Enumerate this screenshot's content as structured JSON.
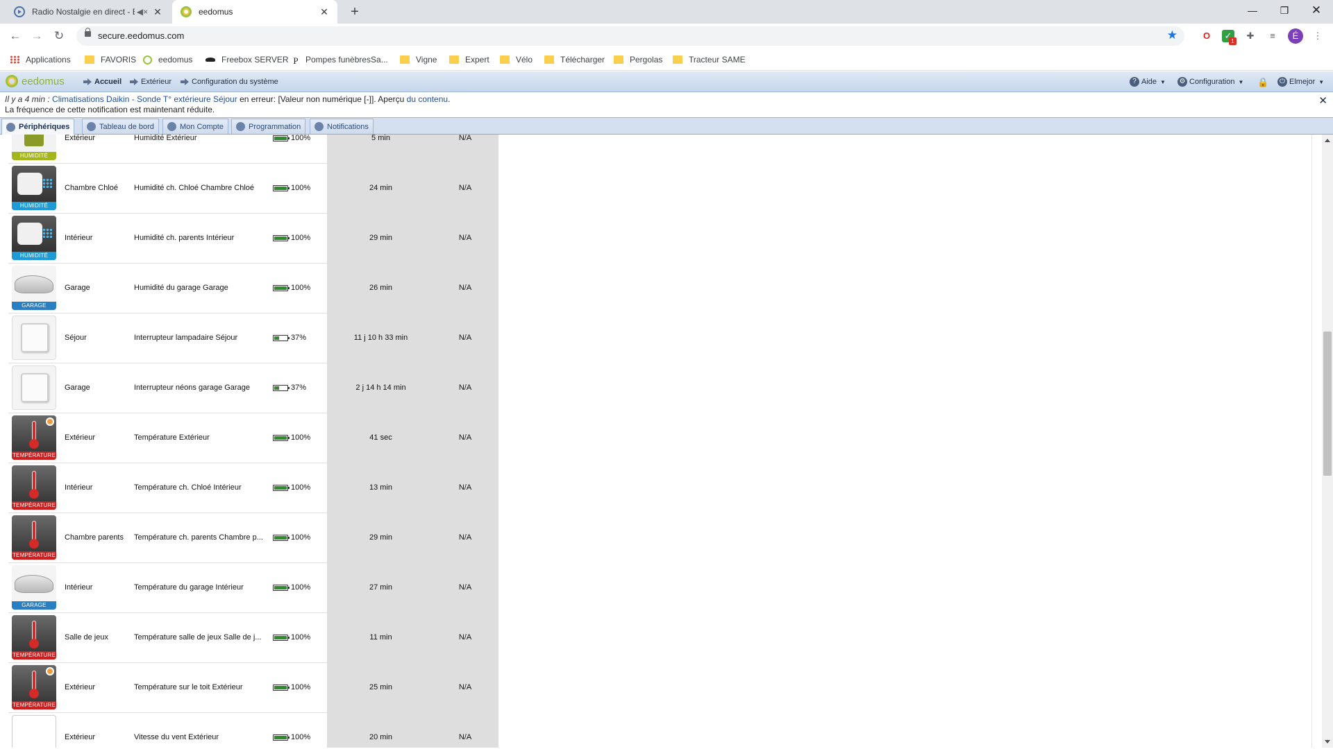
{
  "browser": {
    "tabs": [
      {
        "title": "Radio Nostalgie en direct - É",
        "active": false
      },
      {
        "title": "eedomus",
        "active": true
      }
    ],
    "url": "secure.eedomus.com",
    "profile_initial": "É",
    "extension_badge": "1",
    "bookmarks": [
      {
        "label": "Applications",
        "icon": "apps-grid-icon"
      },
      {
        "label": "FAVORIS",
        "icon": "folder-icon"
      },
      {
        "label": "eedomus",
        "icon": "eedomus-icon"
      },
      {
        "label": "Freebox SERVER",
        "icon": "freebox-icon"
      },
      {
        "label": "Pompes funèbresSa...",
        "icon": "pompes-funebres-icon"
      },
      {
        "label": "Vigne",
        "icon": "folder-icon"
      },
      {
        "label": "Expert",
        "icon": "folder-icon"
      },
      {
        "label": "Vélo",
        "icon": "folder-icon"
      },
      {
        "label": "Télécharger",
        "icon": "folder-icon"
      },
      {
        "label": "Pergolas",
        "icon": "folder-icon"
      },
      {
        "label": "Tracteur SAME",
        "icon": "folder-icon"
      }
    ]
  },
  "app": {
    "logo": "eedomus",
    "breadcrumb": [
      "Accueil",
      "Extérieur",
      "Configuration du système"
    ],
    "help_label": "Aide",
    "config_label": "Configuration",
    "user_label": "Elmejor",
    "notification": {
      "prefix": "Il y a 4 min :",
      "device_link": "Climatisations Daikin - Sonde T° extérieure Séjour",
      "middle": "en erreur: [Valeur non numérique [-]]. Aperçu",
      "content_link": "du contenu",
      "line2": "La fréquence de cette notification est maintenant réduite."
    },
    "tabs": [
      {
        "label": "Périphériques",
        "icon": "gear-icon",
        "active": true
      },
      {
        "label": "Tableau de bord",
        "icon": "dashboard-icon",
        "active": false
      },
      {
        "label": "Mon Compte",
        "icon": "user-icon",
        "active": false
      },
      {
        "label": "Programmation",
        "icon": "wrench-icon",
        "active": false
      },
      {
        "label": "Notifications",
        "icon": "envelope-icon",
        "active": false
      }
    ]
  },
  "devices": [
    {
      "icon": "humidity-exterior-icon",
      "band": "HUMIDITÉ",
      "room": "Extérieur",
      "name": "Humidité Extérieur",
      "battery": "100%",
      "battery_level": 1.0,
      "last": "5 min",
      "value": "N/A"
    },
    {
      "icon": "humidity-icon",
      "band": "HUMIDITÉ",
      "room": "Chambre Chloé",
      "name": "Humidité ch. Chloé Chambre Chloé",
      "battery": "100%",
      "battery_level": 1.0,
      "last": "24 min",
      "value": "N/A"
    },
    {
      "icon": "humidity-icon",
      "band": "HUMIDITÉ",
      "room": "Intérieur",
      "name": "Humidité ch. parents Intérieur",
      "battery": "100%",
      "battery_level": 1.0,
      "last": "29 min",
      "value": "N/A"
    },
    {
      "icon": "garage-icon",
      "band": "GARAGE",
      "room": "Garage",
      "name": "Humidité du garage Garage",
      "battery": "100%",
      "battery_level": 1.0,
      "last": "26 min",
      "value": "N/A"
    },
    {
      "icon": "switch-icon",
      "band": "",
      "room": "Séjour",
      "name": "Interrupteur lampadaire Séjour",
      "battery": "37%",
      "battery_level": 0.37,
      "last": "11 j 10 h 33 min",
      "value": "N/A"
    },
    {
      "icon": "switch-icon",
      "band": "",
      "room": "Garage",
      "name": "Interrupteur néons garage Garage",
      "battery": "37%",
      "battery_level": 0.37,
      "last": "2 j 14 h 14 min",
      "value": "N/A"
    },
    {
      "icon": "temperature-exterior-icon",
      "band": "TEMPÉRATURE",
      "room": "Extérieur",
      "name": "Température Extérieur",
      "battery": "100%",
      "battery_level": 1.0,
      "last": "41 sec",
      "value": "N/A"
    },
    {
      "icon": "temperature-icon",
      "band": "TEMPÉRATURE",
      "room": "Intérieur",
      "name": "Température ch. Chloé Intérieur",
      "battery": "100%",
      "battery_level": 1.0,
      "last": "13 min",
      "value": "N/A"
    },
    {
      "icon": "temperature-icon",
      "band": "TEMPÉRATURE",
      "room": "Chambre parents",
      "name": "Température ch. parents Chambre p...",
      "battery": "100%",
      "battery_level": 1.0,
      "last": "29 min",
      "value": "N/A"
    },
    {
      "icon": "garage-icon",
      "band": "GARAGE",
      "room": "Intérieur",
      "name": "Température du garage Intérieur",
      "battery": "100%",
      "battery_level": 1.0,
      "last": "27 min",
      "value": "N/A"
    },
    {
      "icon": "temperature-icon",
      "band": "TEMPÉRATURE",
      "room": "Salle de jeux",
      "name": "Température salle de jeux Salle de j...",
      "battery": "100%",
      "battery_level": 1.0,
      "last": "11 min",
      "value": "N/A"
    },
    {
      "icon": "temperature-exterior-icon",
      "band": "TEMPÉRATURE",
      "room": "Extérieur",
      "name": "Température sur le toit Extérieur",
      "battery": "100%",
      "battery_level": 1.0,
      "last": "25 min",
      "value": "N/A"
    },
    {
      "icon": "broken-image-icon",
      "band": "",
      "room": "Extérieur",
      "name": "Vitesse du vent Extérieur",
      "battery": "100%",
      "battery_level": 1.0,
      "last": "20 min",
      "value": "N/A"
    }
  ]
}
